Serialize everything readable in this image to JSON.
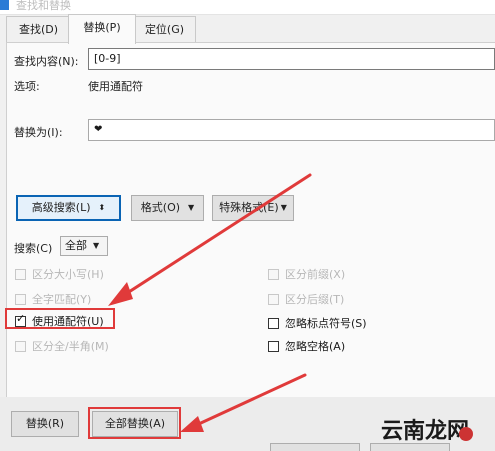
{
  "window": {
    "title": "查找和替换"
  },
  "tabs": [
    {
      "label": "查找(D)"
    },
    {
      "label": "替换(P)"
    },
    {
      "label": "定位(G)"
    }
  ],
  "find": {
    "label": "查找内容(N):",
    "value": "[0-9]"
  },
  "options": {
    "label": "选项:",
    "value": "使用通配符"
  },
  "replace": {
    "label": "替换为(I):",
    "value": "❤"
  },
  "buttons": {
    "advanced_search": "高级搜索(L)",
    "format": "格式(O)",
    "special_format": "特殊格式(E)",
    "replace": "替换(R)",
    "replace_all": "全部替换(A)"
  },
  "search": {
    "label": "搜索(C)",
    "selected": "全部"
  },
  "checkboxes_left": [
    {
      "label": "区分大小写(H)",
      "checked": false,
      "enabled": false
    },
    {
      "label": "全字匹配(Y)",
      "checked": false,
      "enabled": false
    },
    {
      "label": "使用通配符(U)",
      "checked": true,
      "enabled": true
    },
    {
      "label": "区分全/半角(M)",
      "checked": false,
      "enabled": false
    }
  ],
  "checkboxes_right": [
    {
      "label": "区分前缀(X)",
      "checked": false,
      "enabled": false
    },
    {
      "label": "区分后缀(T)",
      "checked": false,
      "enabled": false
    },
    {
      "label": "忽略标点符号(S)",
      "checked": false,
      "enabled": true
    },
    {
      "label": "忽略空格(A)",
      "checked": false,
      "enabled": true
    }
  ],
  "icons": {
    "check": "✓",
    "caret_down": "▼",
    "caret_updown": "⬍"
  },
  "annotation_color": "#e03a3a",
  "watermark": "云南龙网"
}
